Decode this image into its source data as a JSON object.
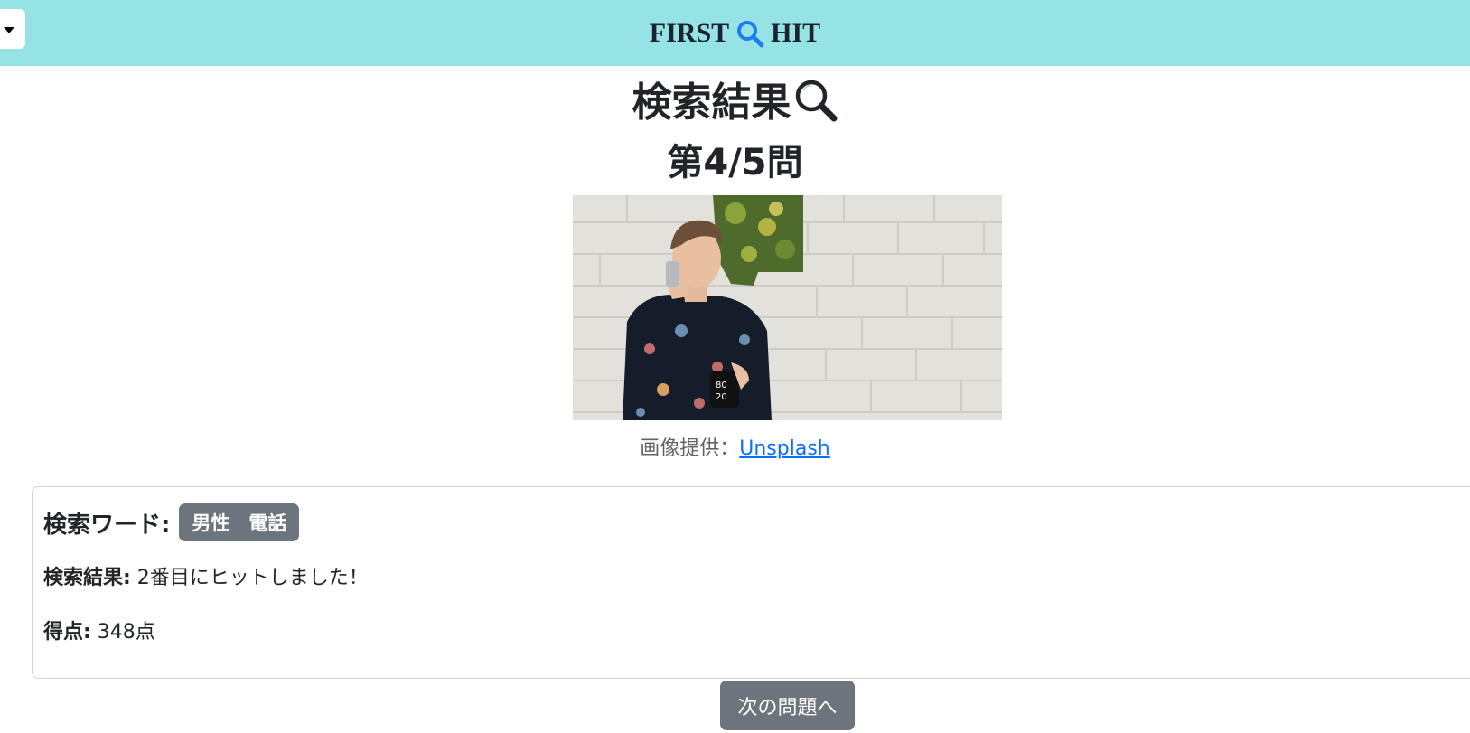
{
  "navbar": {
    "brand_left": "FIRST",
    "brand_right": "HIT",
    "brand_icon": "search-icon",
    "background": "#96e3e5",
    "dropdown_icon": "caret-down-icon"
  },
  "result": {
    "title": "検索結果",
    "title_icon": "magnifier-icon",
    "question": "第4/5問"
  },
  "photo": {
    "description_icon": "man-on-phone-photo"
  },
  "credit": {
    "prefix": "画像提供：",
    "link_text": "Unsplash"
  },
  "card": {
    "keyword_label": "検索ワード:",
    "keywords": "男性　電話",
    "result_label": "検索結果:",
    "result_value": " 2番目にヒットしました！",
    "score_label": "得点:",
    "score_value": " 348点"
  },
  "actions": {
    "next_label": "次の問題へ"
  },
  "colors": {
    "accent": "#0d6efd",
    "badge": "#6c757d"
  }
}
